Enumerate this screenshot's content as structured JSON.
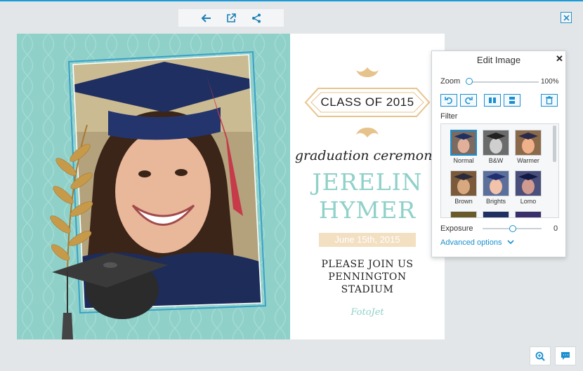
{
  "toolbar": {
    "back_icon": "arrow-left-icon",
    "open_icon": "external-link-icon",
    "share_icon": "share-icon"
  },
  "window": {
    "close_icon": "close-icon"
  },
  "card": {
    "class_of": "CLASS OF 2015",
    "ceremony": "graduation ceremony",
    "first_name": "JERELIN",
    "last_name": "HYMER",
    "date": "June 15th, 2015",
    "join_lines": [
      "PLEASE JOIN US",
      "PENNINGTON",
      "STADIUM"
    ],
    "brand": "FotoJet"
  },
  "edit_panel": {
    "title": "Edit Image",
    "zoom_label": "Zoom",
    "zoom_value": "100%",
    "zoom_fraction": 0.0,
    "tools": [
      "rotate-left-icon",
      "rotate-right-icon",
      "flip-horizontal-icon",
      "flip-vertical-icon",
      "trash-icon"
    ],
    "filter_label": "Filter",
    "filters": [
      {
        "label": "Normal",
        "selected": true,
        "tone": "#7a6a60"
      },
      {
        "label": "B&W",
        "selected": false,
        "tone": "#6b6b6b"
      },
      {
        "label": "Warmer",
        "selected": false,
        "tone": "#8a6a4a"
      },
      {
        "label": "Brown",
        "selected": false,
        "tone": "#7a5a3a"
      },
      {
        "label": "Brights",
        "selected": false,
        "tone": "#5c6e9a"
      },
      {
        "label": "Lomo",
        "selected": false,
        "tone": "#4a4e7a"
      }
    ],
    "exposure_label": "Exposure",
    "exposure_value": "0",
    "exposure_fraction": 0.5,
    "advanced_label": "Advanced options"
  },
  "bottom": {
    "zoom_icon": "zoom-icon",
    "feedback_icon": "chat-icon"
  },
  "colors": {
    "accent": "#1a8fcf",
    "mint": "#8fd1c9",
    "gold": "#e7c38c"
  }
}
